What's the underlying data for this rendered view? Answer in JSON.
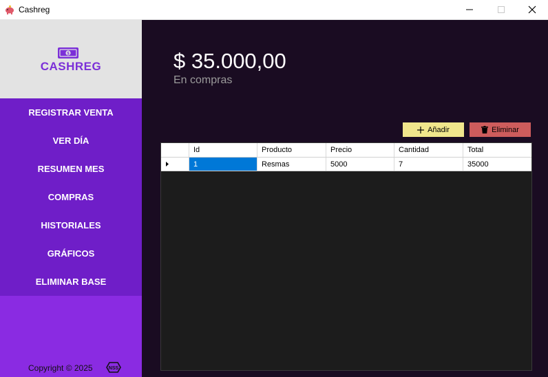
{
  "window": {
    "title": "Cashreg",
    "icon": "piggy-bank-icon"
  },
  "sidebar": {
    "logo_text": "CASHREG",
    "logo_icon": "banknote-icon",
    "menu": [
      "REGISTRAR VENTA",
      "VER DÍA",
      "RESUMEN MES",
      "COMPRAS",
      "HISTORIALES",
      "GRÁFICOS",
      "ELIMINAR BASE"
    ],
    "copyright": "Copyright ©  2025",
    "footer_logo": "NSS"
  },
  "main": {
    "amount": "$ 35.000,00",
    "amount_label": "En compras",
    "add_button": "Añadir",
    "delete_button": "Eliminar",
    "table": {
      "columns": [
        "Id",
        "Producto",
        "Precio",
        "Cantidad",
        "Total"
      ],
      "rows": [
        [
          "1",
          "Resmas",
          "5000",
          "7",
          "35000"
        ]
      ]
    }
  },
  "colors": {
    "sidebar": "#8a2be2",
    "menu": "#6f1ec8",
    "main_bg": "#1a0c22",
    "add": "#f0e68c",
    "delete": "#cd5c5c",
    "selection": "#0078d7"
  }
}
